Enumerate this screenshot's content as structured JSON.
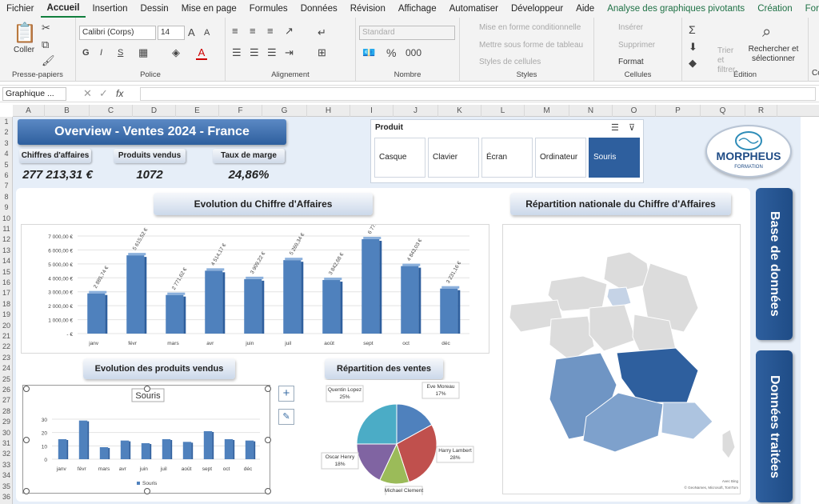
{
  "menu": [
    "Fichier",
    "Accueil",
    "Insertion",
    "Dessin",
    "Mise en page",
    "Formules",
    "Données",
    "Révision",
    "Affichage",
    "Automatiser",
    "Développeur",
    "Aide"
  ],
  "context_tabs": [
    "Analyse des graphiques pivotants",
    "Création",
    "Format"
  ],
  "ribbon": {
    "clipboard": {
      "label": "Presse-papiers",
      "paste": "Coller"
    },
    "font": {
      "label": "Police",
      "name": "Calibri (Corps)",
      "size": "14",
      "bold": "G",
      "italic": "I",
      "underline": "S"
    },
    "alignment": {
      "label": "Alignement"
    },
    "number": {
      "label": "Nombre",
      "format": "Standard"
    },
    "styles": {
      "label": "Styles",
      "cond": "Mise en forme conditionnelle",
      "table": "Mettre sous forme de tableau",
      "cell": "Styles de cellules"
    },
    "cells": {
      "label": "Cellules",
      "insert": "Insérer",
      "delete": "Supprimer",
      "format": "Format"
    },
    "editing": {
      "label": "Édition",
      "sort": "Trier et filtrer",
      "find": "Rechercher et sélectionner"
    },
    "extra": "Co"
  },
  "formula_bar": {
    "name_box": "Graphique ...",
    "fx": "fx"
  },
  "columns": [
    "A",
    "B",
    "C",
    "D",
    "E",
    "F",
    "G",
    "H",
    "I",
    "J",
    "K",
    "L",
    "M",
    "N",
    "O",
    "P",
    "Q",
    "R"
  ],
  "rows": [
    "1",
    "2",
    "3",
    "4",
    "5",
    "6",
    "7",
    "8",
    "9",
    "10",
    "11",
    "12",
    "13",
    "14",
    "15",
    "16",
    "17",
    "18",
    "19",
    "20",
    "21",
    "22",
    "23",
    "24",
    "25",
    "26",
    "27",
    "28",
    "29",
    "30",
    "31",
    "32",
    "33",
    "34",
    "35",
    "36"
  ],
  "dashboard": {
    "title": "Overview -  Ventes 2024 - France",
    "kpis": [
      {
        "label": "Chiffres d'affaires",
        "value": "277 213,31 €"
      },
      {
        "label": "Produits vendus",
        "value": "1072"
      },
      {
        "label": "Taux de marge",
        "value": "24,86%"
      }
    ],
    "slicer": {
      "title": "Produit",
      "items": [
        "Casque",
        "Clavier",
        "Écran",
        "Ordinateur",
        "Souris"
      ],
      "selected": "Souris"
    },
    "logo": {
      "name": "MORPHEUS",
      "sub": "FORMATION"
    },
    "sections": {
      "ca": "Evolution du Chiffre d'Affaires",
      "map": "Répartition nationale du Chiffre d'Affaires",
      "products": "Evolution des produits vendus",
      "sales": "Répartition des ventes"
    },
    "side_buttons": [
      "Base de données",
      "Données traitées"
    ],
    "map_credit": "© GeoNames, Microsoft, TomTom",
    "map_credit2": "Avec Bing"
  },
  "chart_data": [
    {
      "type": "bar",
      "title": "Evolution du Chiffre d'Affaires",
      "categories": [
        "janv",
        "févr",
        "mars",
        "avr",
        "juin",
        "juil",
        "août",
        "sept",
        "oct",
        "déc"
      ],
      "values": [
        2885.74,
        5615.52,
        2771.62,
        4514.17,
        3909.22,
        5269.34,
        3842.68,
        6771.0,
        4843.03,
        3231.16
      ],
      "labels": [
        "2 885,74 €",
        "5 615,52 €",
        "2 771,62 €",
        "4 514,17 €",
        "3 909,22 €",
        "5 269,34 €",
        "3 842,68 €",
        "6 771,...",
        "4 843,03 €",
        "3 231,16 €"
      ],
      "yticks": [
        "7 000,00 €",
        "6 000,00 €",
        "5 000,00 €",
        "4 000,00 €",
        "3 000,00 €",
        "2 000,00 €",
        "1 000,00 €",
        "- €"
      ],
      "ylim": [
        0,
        7000
      ]
    },
    {
      "type": "bar",
      "title": "Souris",
      "categories": [
        "janv",
        "févr",
        "mars",
        "avr",
        "juin",
        "juil",
        "août",
        "sept",
        "oct",
        "déc"
      ],
      "values": [
        15,
        29,
        9,
        14,
        12,
        15,
        13,
        21,
        15,
        14
      ],
      "yticks": [
        "30",
        "20",
        "10",
        "0"
      ],
      "ylim": [
        0,
        30
      ],
      "legend": "Souris"
    },
    {
      "type": "pie",
      "title": "Répartition des ventes",
      "slices": [
        {
          "name": "Eve Moreau",
          "pct": 17,
          "label": "17%",
          "color": "#4f81bd"
        },
        {
          "name": "Harry Lambert",
          "pct": 28,
          "label": "28%",
          "color": "#c0504d"
        },
        {
          "name": "Michael Clement",
          "pct": 12,
          "label": "12%",
          "color": "#9bbb59"
        },
        {
          "name": "Oscar Henry",
          "pct": 18,
          "label": "18%",
          "color": "#8064a2"
        },
        {
          "name": "Quentin Lopez",
          "pct": 25,
          "label": "25%",
          "color": "#4bacc6"
        }
      ]
    }
  ]
}
